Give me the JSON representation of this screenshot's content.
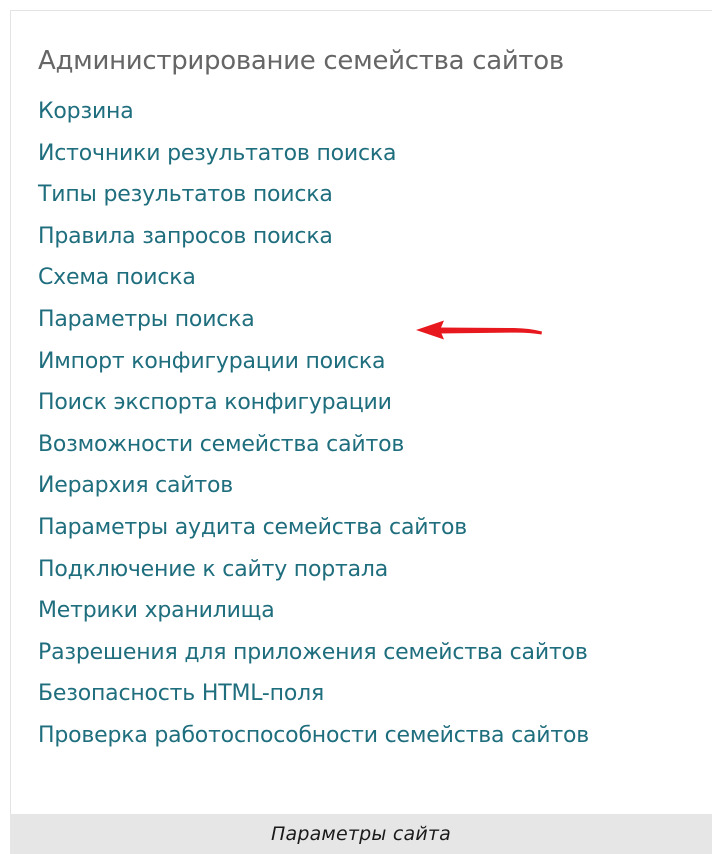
{
  "settings_section": {
    "title": "Администрирование семейства сайтов",
    "links": [
      "Корзина",
      "Источники результатов поиска",
      "Типы результатов поиска",
      "Правила запросов поиска",
      "Схема поиска",
      "Параметры поиска",
      "Импорт конфигурации поиска",
      "Поиск экспорта конфигурации",
      "Возможности семейства сайтов",
      "Иерархия сайтов",
      "Параметры аудита семейства сайтов",
      "Подключение к сайту портала",
      "Метрики хранилища",
      "Разрешения для приложения семейства сайтов",
      "Безопасность HTML-поля",
      "Проверка работоспособности семейства сайтов"
    ]
  },
  "annotation": {
    "color": "#e8191e",
    "icon": "arrow-left-icon"
  },
  "caption": {
    "text": "Параметры сайта"
  }
}
